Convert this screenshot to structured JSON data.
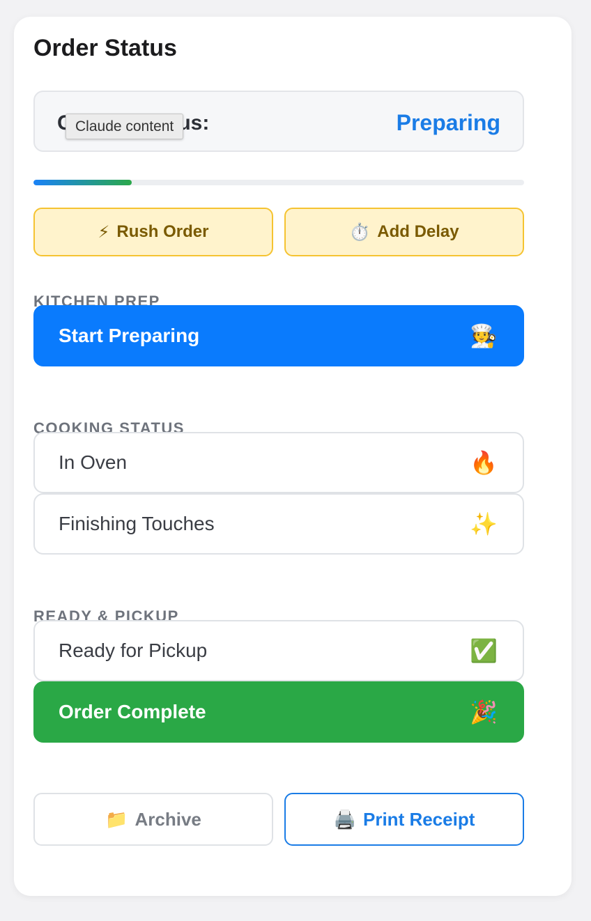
{
  "header": {
    "title": "Order Status"
  },
  "status": {
    "label": "Current Status:",
    "value": "Preparing",
    "tooltip": "Claude content"
  },
  "progress": {
    "fraction": 0.2
  },
  "quick_actions": {
    "rush": {
      "icon": "⚡",
      "icon_name": "lightning-icon",
      "label": "Rush Order"
    },
    "delay": {
      "icon": "⏱️",
      "icon_name": "stopwatch-icon",
      "label": "Add Delay"
    }
  },
  "sections": {
    "kitchen_prep": {
      "label": "KITCHEN PREP",
      "steps": [
        {
          "label": "Start Preparing",
          "icon": "🧑‍🍳",
          "icon_name": "chef-icon"
        }
      ]
    },
    "cooking_status": {
      "label": "COOKING STATUS",
      "steps": [
        {
          "label": "In Oven",
          "icon": "🔥",
          "icon_name": "fire-icon"
        },
        {
          "label": "Finishing Touches",
          "icon": "✨",
          "icon_name": "sparkles-icon"
        }
      ]
    },
    "ready_pickup": {
      "label": "READY & PICKUP",
      "steps": [
        {
          "label": "Ready for Pickup",
          "icon": "✅",
          "icon_name": "check-mark-icon"
        },
        {
          "label": "Order Complete",
          "icon": "🎉",
          "icon_name": "party-popper-icon"
        }
      ]
    }
  },
  "footer": {
    "archive": {
      "icon": "📁",
      "icon_name": "folder-icon",
      "label": "Archive"
    },
    "print": {
      "icon": "🖨️",
      "icon_name": "printer-icon",
      "label": "Print Receipt"
    }
  },
  "colors": {
    "accent_blue": "#0a7bfd",
    "status_text_blue": "#1a7ce6",
    "complete_green": "#2aa846",
    "warning_bg": "#fff3cc",
    "warning_border": "#f5c331"
  }
}
